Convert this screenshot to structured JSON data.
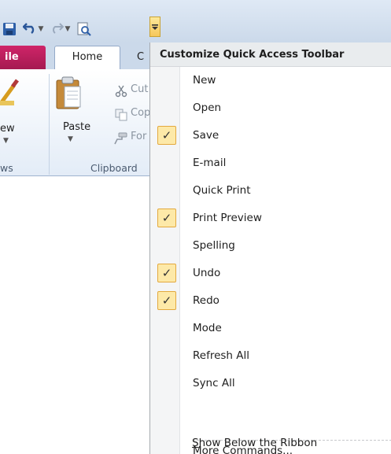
{
  "qat": {
    "save_icon": "save-icon",
    "undo_icon": "undo-icon",
    "redo_icon": "redo-icon",
    "print_preview_icon": "print-preview-icon",
    "customize_icon": "customize-dropdown-icon"
  },
  "tabs": {
    "file": "ile",
    "home": "Home",
    "next": "C"
  },
  "ribbon": {
    "view_button": "ew",
    "views_group": "ws",
    "paste_button": "Paste",
    "cut": "Cut",
    "copy": "Cop",
    "format": "For",
    "clipboard_group": "Clipboard"
  },
  "menu": {
    "title": "Customize Quick Access Toolbar",
    "items": [
      {
        "label": "New",
        "checked": false
      },
      {
        "label": "Open",
        "checked": false
      },
      {
        "label": "Save",
        "checked": true
      },
      {
        "label": "E-mail",
        "checked": false
      },
      {
        "label": "Quick Print",
        "checked": false
      },
      {
        "label": "Print Preview",
        "checked": true
      },
      {
        "label": "Spelling",
        "checked": false
      },
      {
        "label": "Undo",
        "checked": true
      },
      {
        "label": "Redo",
        "checked": true
      },
      {
        "label": "Mode",
        "checked": false
      },
      {
        "label": "Refresh All",
        "checked": false
      },
      {
        "label": "Sync All",
        "checked": false
      }
    ],
    "more_commands_key": "M",
    "more_commands_rest": "ore Commands...",
    "show_below_key": "S",
    "show_below_rest": "how Below the Ribbon",
    "check_mark": "✓"
  },
  "colors": {
    "file_tab": "#b81e5c",
    "check_bg": "#fde9a8",
    "check_border": "#e3a93e"
  }
}
